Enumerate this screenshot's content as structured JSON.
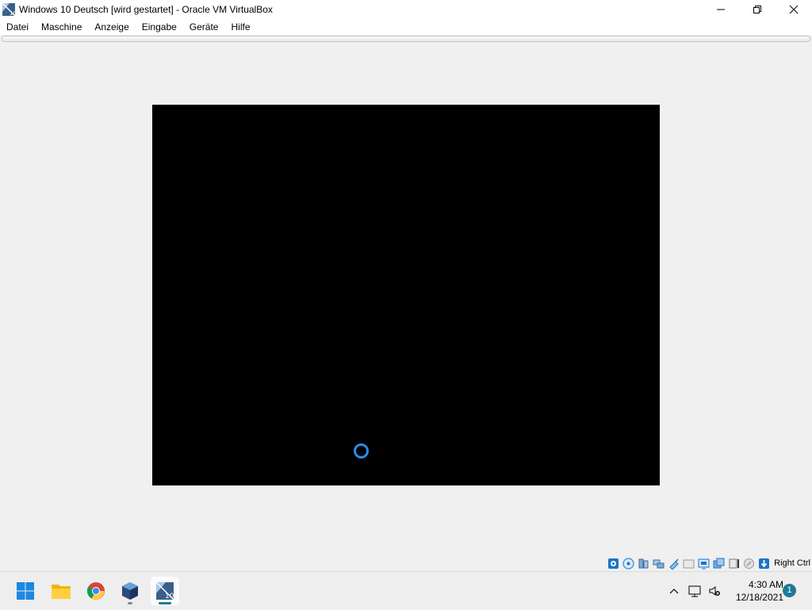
{
  "window": {
    "title": "Windows 10 Deutsch [wird gestartet] - Oracle VM VirtualBox",
    "app_icon": "virtualbox-vm-icon"
  },
  "menu": {
    "items": [
      {
        "label": "Datei"
      },
      {
        "label": "Maschine"
      },
      {
        "label": "Anzeige"
      },
      {
        "label": "Eingabe"
      },
      {
        "label": "Geräte"
      },
      {
        "label": "Hilfe"
      }
    ]
  },
  "vm": {
    "state_indicator": "loading-spinner-icon"
  },
  "statusbar": {
    "icons": [
      "hard-disk-icon",
      "optical-drive-icon",
      "audio-icon",
      "network-icon",
      "usb-icon",
      "shared-folders-icon",
      "display-icon",
      "recording-icon",
      "cpu-icon",
      "mouse-integration-icon",
      "host-key-icon"
    ],
    "host_key": "Right Ctrl"
  },
  "taskbar": {
    "apps": [
      "windows-start-icon",
      "file-explorer-icon",
      "chrome-icon",
      "virtualbox-icon",
      "vm-window-icon"
    ],
    "clock_time": "4:30 AM",
    "clock_date": "12/18/2021",
    "notification_count": "1"
  },
  "colors": {
    "accent": "#2b8ce8",
    "notification": "#1e7a94"
  }
}
